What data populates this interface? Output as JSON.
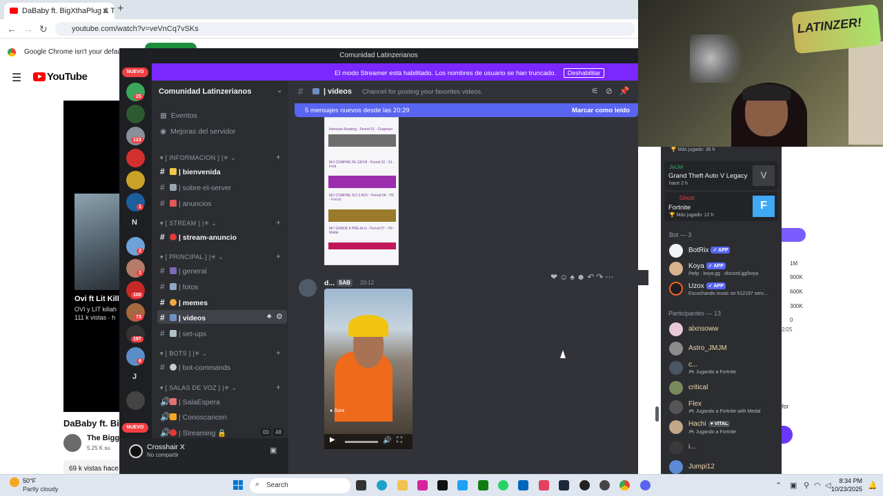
{
  "browser": {
    "tab_title": "DaBaby ft. BigXthaPlug & That",
    "url": "youtube.com/watch?v=veVnCq7vSKs",
    "info_text": "Google Chrome isn't your default b"
  },
  "youtube": {
    "logo_text": "YouTube",
    "video_overlay_title": "Ovi ft Lit Killa",
    "video_overlay_sub1": "OVI y LIT killah",
    "video_overlay_sub2": "111 k vistas · h",
    "title": "DaBaby ft. Big",
    "channel": "The Bigge",
    "subs": "5.25 K su",
    "views": "69 k vistas  hace",
    "chart_ticks": [
      "1M",
      "900K",
      "600K",
      "300K",
      "0"
    ],
    "chart_date": "2/25",
    "for_text": "for"
  },
  "discord": {
    "window_title": "Comunidad Latinzerianos",
    "streamer_banner": "El modo Streamer está habilitado. Los nombres de usuario se han truncado.",
    "streamer_button": "Deshabilitar",
    "new_badge": "NUEVO",
    "guild_badges": [
      "25",
      "123",
      "1",
      "2",
      "1",
      "100",
      "73",
      "197",
      "6"
    ],
    "guild_letters": [
      "N",
      "J"
    ],
    "server_name": "Comunidad Latinzerianos",
    "top_items": [
      "Eventos",
      "Mejoras del servidor"
    ],
    "categories": {
      "info": "[ INFORMACION ] |✳",
      "stream": "[ STREAM ] |✳",
      "principal": "[ PRINCIPAL ] |✳",
      "bots": "[ BOTS ] |✳",
      "voice": "[ SALAS DE VOZ ] |✳"
    },
    "channels": {
      "bienvenida": "| bienvenida",
      "sobre": "| sobre-el-server",
      "anuncios": "| anuncios",
      "stream_anuncio": "| stream-anuncio",
      "general": "| general",
      "fotos": "| fotos",
      "memes": "| memes",
      "videos": "| videos",
      "setups": "| set-ups",
      "botcmds": "| bot-commands",
      "salaespera": "| SalaEspera",
      "conoscancen": "| Conoscancen",
      "streaming": "| Streaming 🔒"
    },
    "voice_counts": [
      "00",
      "48"
    ],
    "user": {
      "name": "Crosshair X",
      "status": "No compartir"
    },
    "chat": {
      "channel": "| videos",
      "topic": "Channel for posting your favorites videos.",
      "new_messages": "5 mensajes nuevos desde las 20:29",
      "mark_read": "Marcar como leído",
      "sched_titles": [
        "Intensive Reading - Period 01 - Chapman",
        "M/J COMPRE PE GR7/8 - Period 02 - S1 - Ford",
        "M/J COMPRE SCI 3 ADV - Period 04 - YR - Forcal",
        "M/J GRADE 8 PRE-ALG - Period 07 - YR - Mattie"
      ],
      "msg_author": "d...",
      "msg_tag": "SAB",
      "msg_time": "20:12",
      "video_label": "Sora"
    },
    "members": {
      "played1": "Más jugado: 36 h",
      "act1_user": "JeiJei",
      "act1_game": "Grand Theft Auto V Legacy",
      "act1_time": "hace 2 h",
      "act2_user": "Ghost",
      "act2_game": "Fortnite",
      "act2_time": "Más jugado: 12 h",
      "bot_header": "Bot — 3",
      "bots": [
        {
          "name": "BotRix",
          "sub": ""
        },
        {
          "name": "Koya",
          "sub": "/help · koya.gg · discord.gg/koya"
        },
        {
          "name": "Uzox",
          "sub": "Escuchando music on 512197 serv..."
        }
      ],
      "app_label": "APP",
      "participants_header": "Participantes — 13",
      "participants": [
        {
          "name": "alxnsoww",
          "sub": ""
        },
        {
          "name": "Astro_JMJM",
          "sub": ""
        },
        {
          "name": "c...",
          "sub": "Jugando a Fortnite"
        },
        {
          "name": "critical",
          "sub": ""
        },
        {
          "name": "Flex",
          "sub": "Jugando a Fortnite with Medal"
        },
        {
          "name": "Hachi",
          "sub": "Jugando a Fortnite"
        },
        {
          "name": "i...",
          "sub": ""
        },
        {
          "name": "Jumpi12",
          "sub": ""
        }
      ],
      "vital_tag": "VITAL"
    }
  },
  "webcam": {
    "sign": "LATINZER!"
  },
  "taskbar": {
    "temp": "50°F",
    "weather": "Partly cloudy",
    "search": "Search",
    "time": "8:34 PM",
    "date": "10/23/2025"
  }
}
